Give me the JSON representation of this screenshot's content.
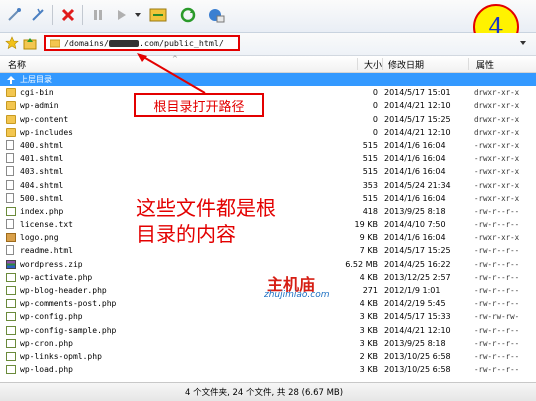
{
  "toolbar": {
    "buttons": [
      {
        "name": "connect-icon"
      },
      {
        "name": "disconnect-icon"
      },
      {
        "name": "delete-icon"
      },
      {
        "name": "pause-icon"
      },
      {
        "name": "transfer-icon"
      },
      {
        "name": "compress-icon"
      },
      {
        "name": "refresh-icon"
      },
      {
        "name": "site-manager-icon"
      }
    ],
    "step_badge": "4"
  },
  "address": {
    "path_prefix": "/domains/",
    "path_suffix": ".com/public_html/"
  },
  "columns": {
    "name": "名称",
    "size": "大小",
    "modified": "修改日期",
    "attributes": "属性"
  },
  "files": [
    {
      "name": "上层目录",
      "size": "",
      "date": "",
      "attr": "",
      "type": "up"
    },
    {
      "name": "cgi-bin",
      "size": "0",
      "date": "2014/5/17 15:01",
      "attr": "drwxr-xr-x",
      "type": "folder"
    },
    {
      "name": "wp-admin",
      "size": "0",
      "date": "2014/4/21 12:10",
      "attr": "drwxr-xr-x",
      "type": "folder"
    },
    {
      "name": "wp-content",
      "size": "0",
      "date": "2014/5/17 15:25",
      "attr": "drwxr-xr-x",
      "type": "folder"
    },
    {
      "name": "wp-includes",
      "size": "0",
      "date": "2014/4/21 12:10",
      "attr": "drwxr-xr-x",
      "type": "folder"
    },
    {
      "name": "400.shtml",
      "size": "515",
      "date": "2014/1/6 16:04",
      "attr": "-rwxr-xr-x",
      "type": "file"
    },
    {
      "name": "401.shtml",
      "size": "515",
      "date": "2014/1/6 16:04",
      "attr": "-rwxr-xr-x",
      "type": "file"
    },
    {
      "name": "403.shtml",
      "size": "515",
      "date": "2014/1/6 16:04",
      "attr": "-rwxr-xr-x",
      "type": "file"
    },
    {
      "name": "404.shtml",
      "size": "353",
      "date": "2014/5/24 21:34",
      "attr": "-rwxr-xr-x",
      "type": "file"
    },
    {
      "name": "500.shtml",
      "size": "515",
      "date": "2014/1/6 16:04",
      "attr": "-rwxr-xr-x",
      "type": "file"
    },
    {
      "name": "index.php",
      "size": "418",
      "date": "2013/9/25 8:18",
      "attr": "-rw-r--r--",
      "type": "php"
    },
    {
      "name": "license.txt",
      "size": "19 KB",
      "date": "2014/4/10 7:50",
      "attr": "-rw-r--r--",
      "type": "file"
    },
    {
      "name": "logo.png",
      "size": "9 KB",
      "date": "2014/1/6 16:04",
      "attr": "-rwxr-xr-x",
      "type": "png"
    },
    {
      "name": "readme.html",
      "size": "7 KB",
      "date": "2014/5/17 15:25",
      "attr": "-rw-r--r--",
      "type": "file"
    },
    {
      "name": "wordpress.zip",
      "size": "6.52 MB",
      "date": "2014/4/25 16:22",
      "attr": "-rw-r--r--",
      "type": "zip"
    },
    {
      "name": "wp-activate.php",
      "size": "4 KB",
      "date": "2013/12/25 2:57",
      "attr": "-rw-r--r--",
      "type": "php"
    },
    {
      "name": "wp-blog-header.php",
      "size": "271",
      "date": "2012/1/9 1:01",
      "attr": "-rw-r--r--",
      "type": "php"
    },
    {
      "name": "wp-comments-post.php",
      "size": "4 KB",
      "date": "2014/2/19 5:45",
      "attr": "-rw-r--r--",
      "type": "php"
    },
    {
      "name": "wp-config.php",
      "size": "3 KB",
      "date": "2014/5/17 15:33",
      "attr": "-rw-rw-rw-",
      "type": "php"
    },
    {
      "name": "wp-config-sample.php",
      "size": "3 KB",
      "date": "2014/4/21 12:10",
      "attr": "-rw-r--r--",
      "type": "php"
    },
    {
      "name": "wp-cron.php",
      "size": "3 KB",
      "date": "2013/9/25 8:18",
      "attr": "-rw-r--r--",
      "type": "php"
    },
    {
      "name": "wp-links-opml.php",
      "size": "2 KB",
      "date": "2013/10/25 6:58",
      "attr": "-rw-r--r--",
      "type": "php"
    },
    {
      "name": "wp-load.php",
      "size": "3 KB",
      "date": "2013/10/25 6:58",
      "attr": "-rw-r--r--",
      "type": "php"
    }
  ],
  "annotations": {
    "path_note": "根目录打开路径",
    "content_note_line1": "这些文件都是根",
    "content_note_line2": "目录的内容",
    "watermark_cn": "主机庙",
    "watermark_en": "zhujimiao.com"
  },
  "status": {
    "summary": "4 个文件夹, 24 个文件, 共 28 (6.67 MB)"
  },
  "colors": {
    "selection": "#3399ff",
    "annotation_red": "#e30000",
    "badge_fill": "#fff200",
    "badge_text": "#1a35c7"
  }
}
